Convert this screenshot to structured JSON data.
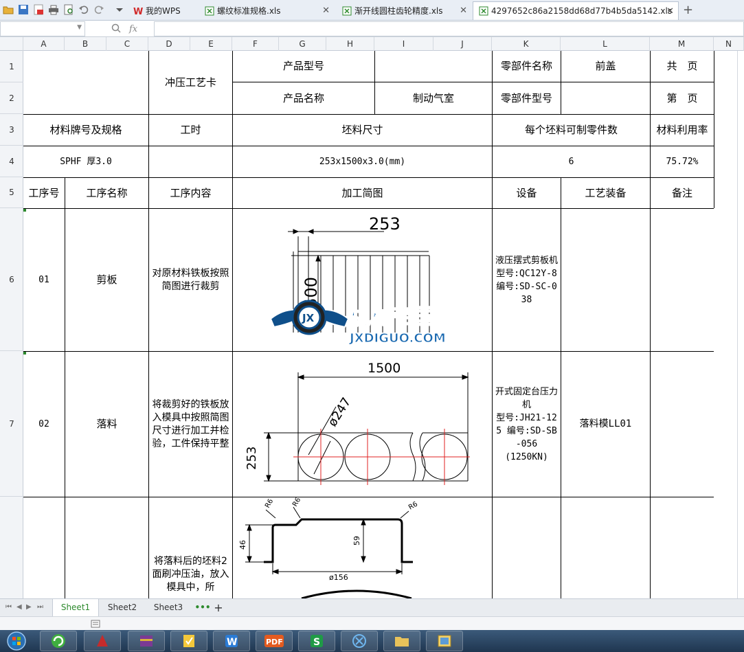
{
  "app": {
    "tabs": [
      {
        "label": "我的WPS",
        "active": false
      },
      {
        "label": "螺纹标准规格.xls",
        "active": false
      },
      {
        "label": "渐开线圆柱齿轮精度.xls",
        "active": false
      },
      {
        "label": "4297652c86a2158dd68d77b4b5da5142.xls",
        "active": true
      }
    ],
    "formula": {
      "fx": "fx",
      "value": ""
    }
  },
  "grid": {
    "columns": [
      "A",
      "B",
      "C",
      "D",
      "E",
      "F",
      "G",
      "H",
      "I",
      "J",
      "K",
      "L",
      "M",
      "N"
    ],
    "rows": [
      "1",
      "2",
      "3",
      "4",
      "5",
      "6",
      "7",
      ""
    ]
  },
  "sheet": {
    "title": "冲压工艺卡",
    "product_model_label": "产品型号",
    "product_model_value": "",
    "part_name_label": "零部件名称",
    "part_name_value": "前盖",
    "total_pages_label": "共　页",
    "product_name_label": "产品名称",
    "product_name_value": "制动气室",
    "part_model_label": "零部件型号",
    "part_model_value": "",
    "page_label": "第　页",
    "material_label": "材料牌号及规格",
    "hours_label": "工时",
    "blank_size_label": "坯料尺寸",
    "parts_per_blank_label": "每个坯料可制零件数",
    "utilization_label": "材料利用率",
    "material_value": "SPHF 厚3.0",
    "hours_value": "",
    "blank_size_value": "253x1500x3.0(mm)",
    "parts_per_blank_value": "6",
    "utilization_value": "75.72%",
    "headers": [
      "工序号",
      "工序名称",
      "工序内容",
      "加工简图",
      "设备",
      "工艺装备",
      "备注"
    ],
    "ops": [
      {
        "no": "01",
        "name": "剪板",
        "content": "对原材料铁板按照简图进行裁剪",
        "equipment": "液压摆式剪板机\n型号:QC12Y-8  编号:SD-SC-038",
        "tooling": "",
        "note": ""
      },
      {
        "no": "02",
        "name": "落料",
        "content": "将裁剪好的铁板放入模具中按照简图尺寸进行加工并检验，工件保持平整",
        "equipment": "开式固定台压力机\n型号:JH21-125 编号:SD-SB-056\n(1250KN)",
        "tooling": "落料模LL01",
        "note": ""
      },
      {
        "no": "",
        "name": "",
        "content": "将落料后的坯料2面刷冲压油，放入模具中，所",
        "equipment": "",
        "tooling": "",
        "note": ""
      }
    ],
    "drawing1": {
      "dim_width": "253",
      "dim_length": "1500"
    },
    "drawing2": {
      "dim_length": "1500",
      "dim_dia": "ø247",
      "dim_width": "253"
    },
    "drawing3": {
      "r1": "R6",
      "r2": "R6",
      "r3": "R6",
      "h1": "46",
      "h2": "59",
      "dia": "ø156"
    },
    "watermark": {
      "cn": "机械帝国",
      "en": "JXDIGUO.COM",
      "badge": "JX"
    }
  },
  "sheet_tabs": [
    "Sheet1",
    "Sheet2",
    "Sheet3"
  ],
  "sheet_tab_more": "•••",
  "sheet_tab_add": "+",
  "colors": {
    "accent_green": "#2d8a2d",
    "grid_line": "#000000",
    "red_line": "#e02020"
  }
}
